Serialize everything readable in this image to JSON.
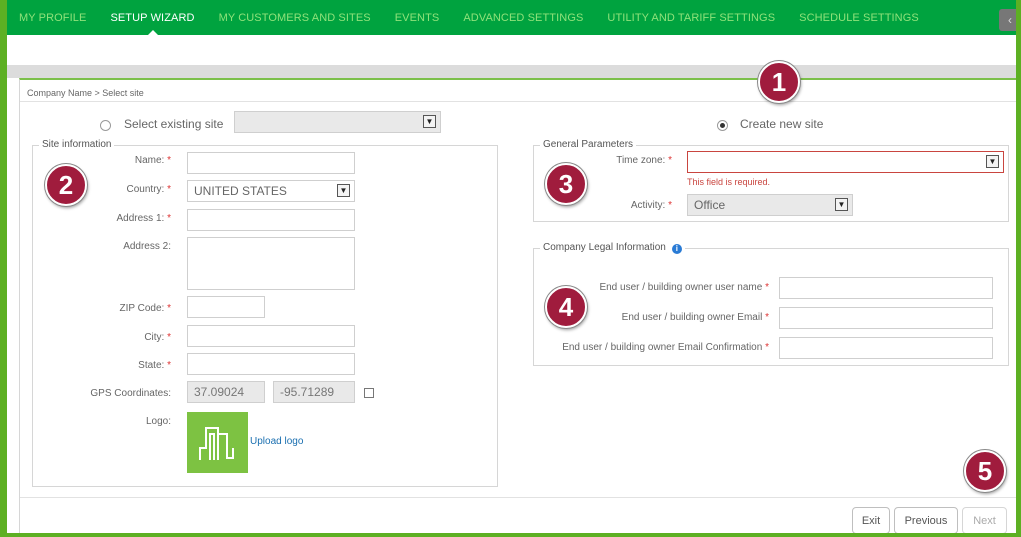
{
  "nav": {
    "items": [
      {
        "label": "MY PROFILE",
        "active": false
      },
      {
        "label": "SETUP WIZARD",
        "active": true
      },
      {
        "label": "MY CUSTOMERS AND SITES",
        "active": false
      },
      {
        "label": "EVENTS",
        "active": false
      },
      {
        "label": "ADVANCED SETTINGS",
        "active": false
      },
      {
        "label": "UTILITY AND TARIFF SETTINGS",
        "active": false
      },
      {
        "label": "SCHEDULE SETTINGS",
        "active": false
      }
    ],
    "collapse_icon": "chevron-left-icon"
  },
  "breadcrumb": "Company Name > Select site",
  "site_choice": {
    "existing_label": "Select existing site",
    "existing_value": "",
    "new_label": "Create new site",
    "selected": "new"
  },
  "site_info": {
    "legend": "Site information",
    "name_label": "Name:",
    "country_label": "Country:",
    "country_value": "UNITED STATES",
    "address1_label": "Address 1:",
    "address2_label": "Address 2:",
    "zip_label": "ZIP Code:",
    "city_label": "City:",
    "state_label": "State:",
    "gps_label": "GPS Coordinates:",
    "gps_lat": "37.09024",
    "gps_lng": "-95.71289",
    "logo_label": "Logo:",
    "upload_label": "Upload logo",
    "required_mark": "*"
  },
  "general_params": {
    "legend": "General Parameters",
    "timezone_label": "Time zone:",
    "timezone_value": "",
    "timezone_error": "This field is required.",
    "activity_label": "Activity:",
    "activity_value": "Office"
  },
  "legal_info": {
    "legend": "Company Legal Information",
    "username_label": "End user / building owner user name",
    "email_label": "End user / building owner Email",
    "email_confirm_label": "End user / building owner Email Confirmation"
  },
  "footer": {
    "exit_label": "Exit",
    "previous_label": "Previous",
    "next_label": "Next"
  },
  "badges": [
    "1",
    "2",
    "3",
    "4",
    "5"
  ],
  "colors": {
    "nav_bg": "#00a33f",
    "accent_green": "#5db023",
    "badge": "#a01c3d",
    "error": "#c9453f",
    "link": "#1a6fb0"
  }
}
